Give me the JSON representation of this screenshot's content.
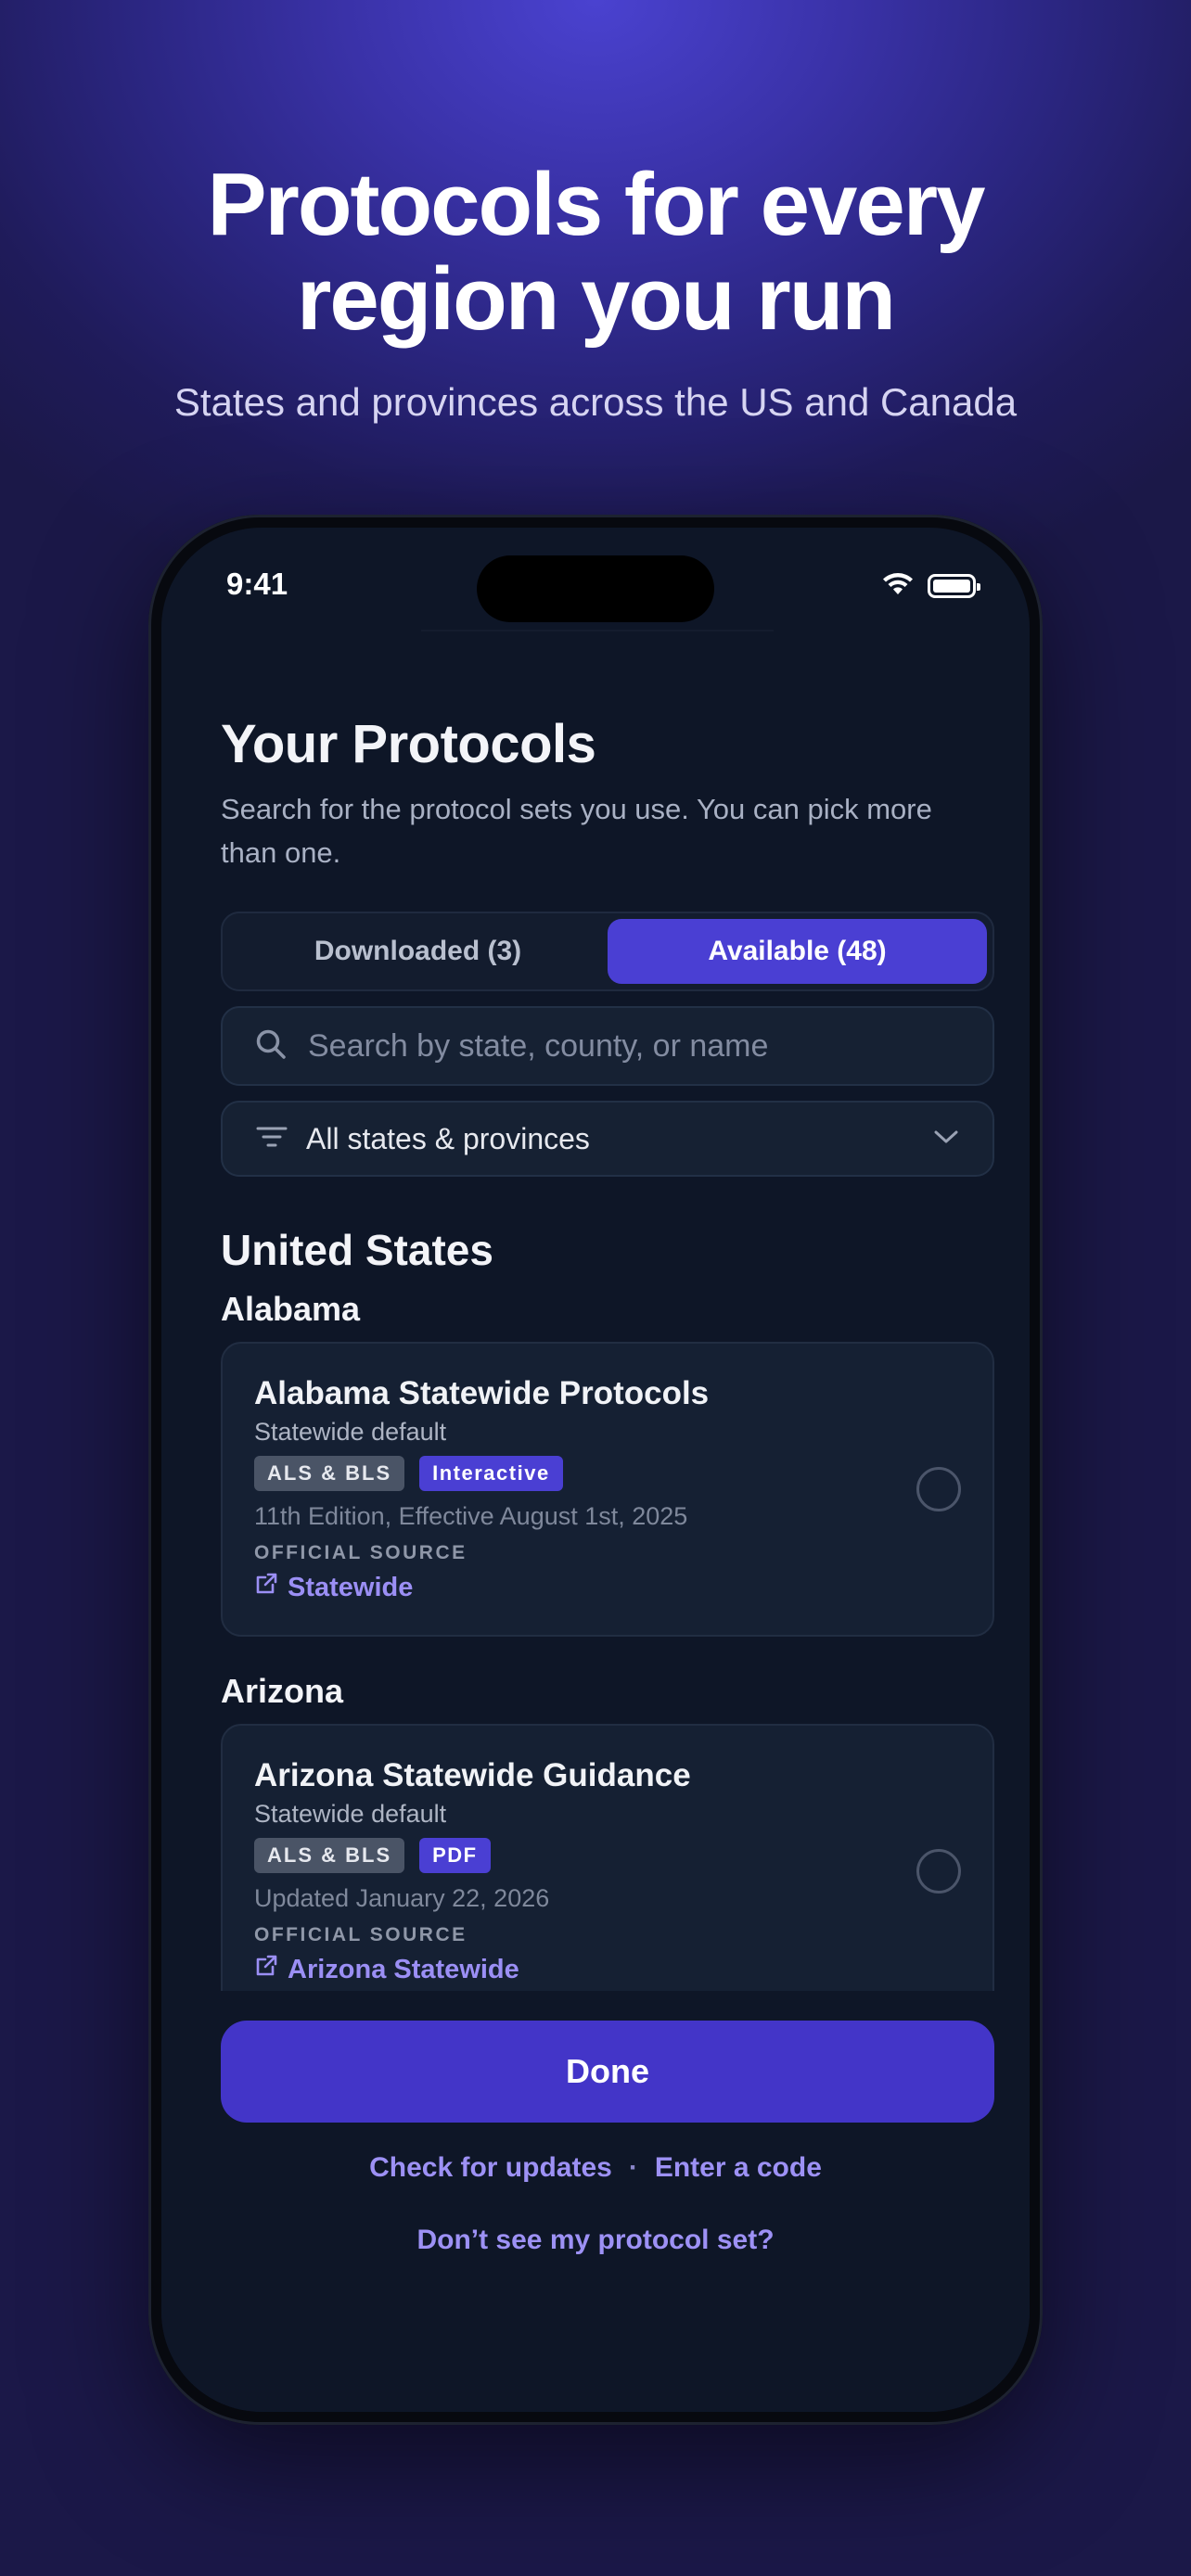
{
  "hero": {
    "title_line1": "Protocols for every",
    "title_line2": "region you run",
    "subtitle": "States and provinces across the US and Canada"
  },
  "status_bar": {
    "time": "9:41",
    "icons": [
      "wifi-icon",
      "battery-icon"
    ]
  },
  "page": {
    "title": "Your Protocols",
    "description": "Search for the protocol sets you use. You can pick more than one."
  },
  "tabs": [
    {
      "label": "Downloaded (3)",
      "active": false
    },
    {
      "label": "Available (48)",
      "active": true
    }
  ],
  "search": {
    "placeholder": "Search by state, county, or name",
    "icon": "search-icon"
  },
  "filter": {
    "value": "All states & provinces",
    "icon": "filter-icon"
  },
  "section": {
    "title": "United States"
  },
  "groups": [
    {
      "state": "Alabama",
      "card": {
        "title": "Alabama Statewide Protocols",
        "subtitle": "Statewide default",
        "badges": [
          "ALS & BLS",
          "Interactive"
        ],
        "meta": "11th Edition, Effective August 1st, 2025",
        "source_label": "OFFICIAL SOURCE",
        "source_link": "Statewide",
        "selected": false
      }
    },
    {
      "state": "Arizona",
      "card": {
        "title": "Arizona Statewide Guidance",
        "subtitle": "Statewide default",
        "badges": [
          "ALS & BLS",
          "PDF"
        ],
        "meta": "Updated January 22, 2026",
        "source_label": "OFFICIAL SOURCE",
        "source_link": "Arizona Statewide",
        "selected": false
      }
    }
  ],
  "footer": {
    "done_label": "Done",
    "check_updates": "Check for updates",
    "separator": "·",
    "enter_code": "Enter a code",
    "help": "Don’t see my protocol set?"
  },
  "colors": {
    "accent": "#4a3fd3",
    "link": "#9d91f5",
    "background": "#0e1627"
  }
}
